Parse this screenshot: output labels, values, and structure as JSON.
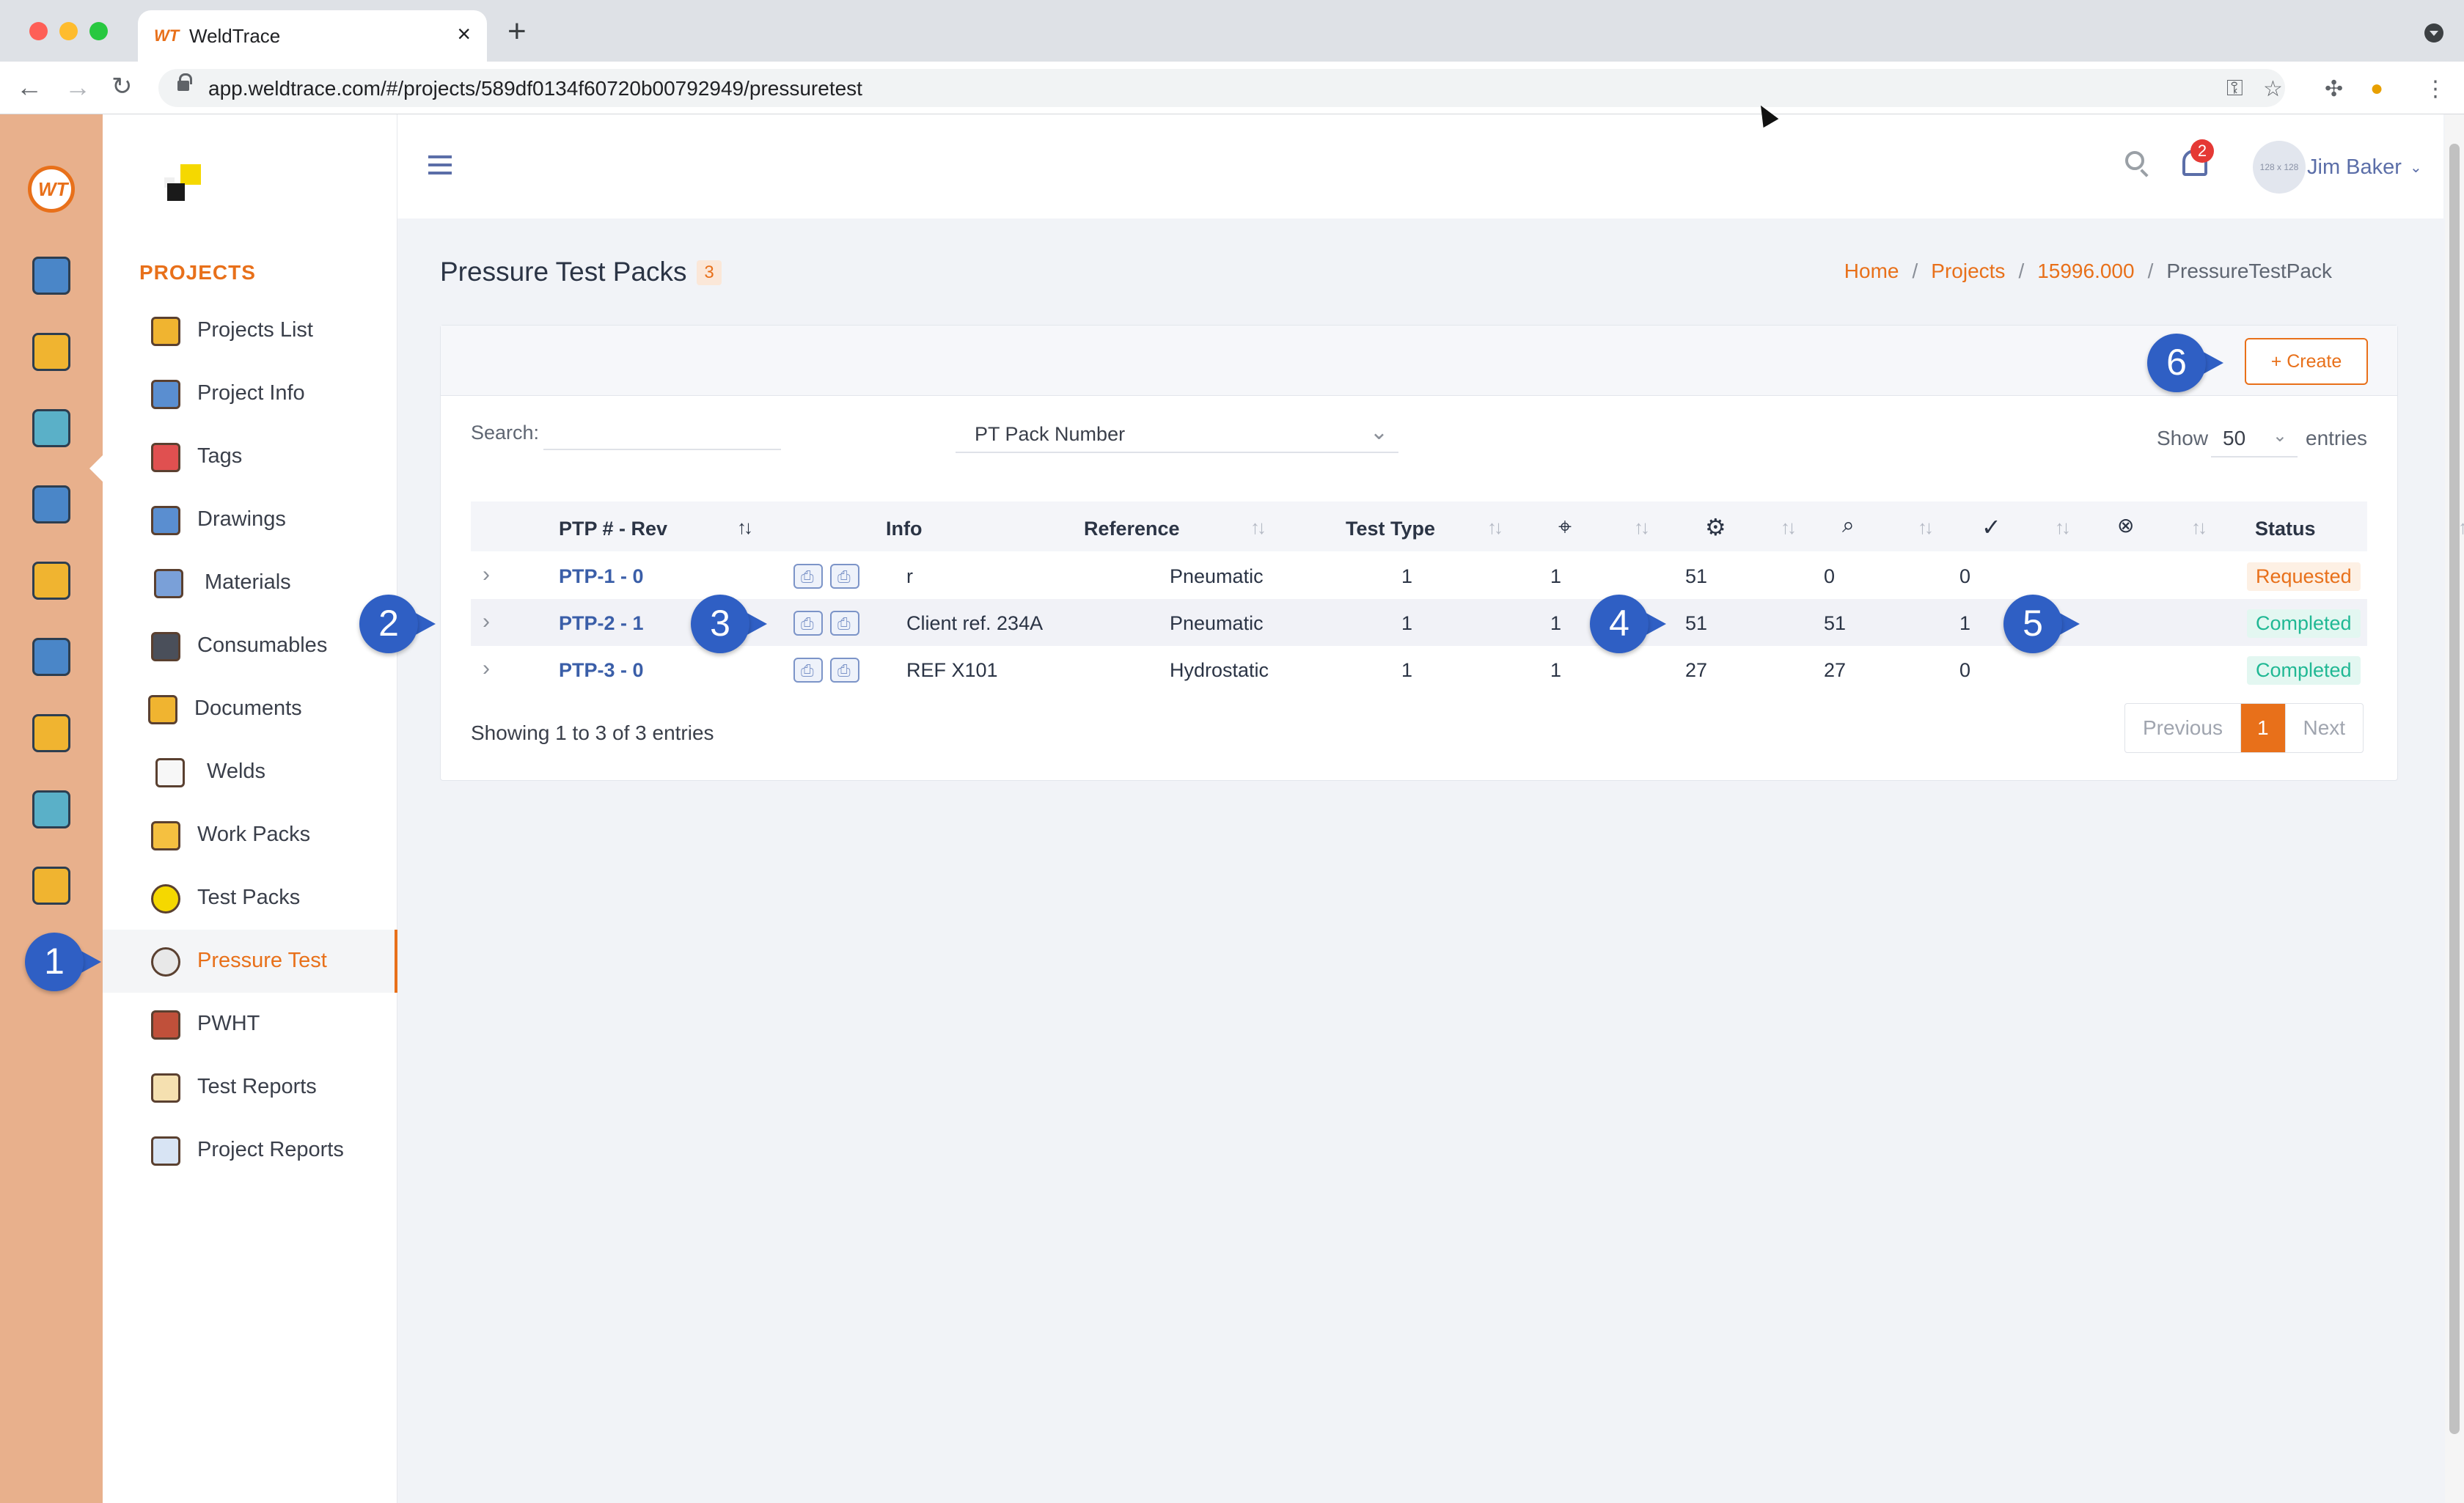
{
  "browser": {
    "tab_title": "WeldTrace",
    "tab_favicon": "WT",
    "url": "app.weldtrace.com/#/projects/589df0134f60720b00792949/pressuretest"
  },
  "sidebar": {
    "heading": "PROJECTS",
    "items": [
      {
        "label": "Projects List",
        "icon": "folder-camera-icon"
      },
      {
        "label": "Project Info",
        "icon": "gears-icon"
      },
      {
        "label": "Tags",
        "icon": "tag-icon"
      },
      {
        "label": "Drawings",
        "icon": "drawing-icon"
      },
      {
        "label": "Materials",
        "icon": "pipes-icon"
      },
      {
        "label": "Consumables",
        "icon": "spool-icon"
      },
      {
        "label": "Documents",
        "icon": "folder-icon"
      },
      {
        "label": "Welds",
        "icon": "weld-spark-icon"
      },
      {
        "label": "Work Packs",
        "icon": "package-icon"
      },
      {
        "label": "Test Packs",
        "icon": "radiation-icon"
      },
      {
        "label": "Pressure Test",
        "icon": "pressure-gauge-icon"
      },
      {
        "label": "PWHT",
        "icon": "heater-coil-icon"
      },
      {
        "label": "Test Reports",
        "icon": "clipboard-icon"
      },
      {
        "label": "Project Reports",
        "icon": "report-chart-icon"
      }
    ]
  },
  "header": {
    "notification_count": "2",
    "avatar_text": "128 x 128",
    "user_name": "Jim Baker"
  },
  "page": {
    "title": "Pressure Test Packs",
    "count": "3",
    "breadcrumb": {
      "home": "Home",
      "projects": "Projects",
      "project": "15996.000",
      "current": "PressureTestPack"
    }
  },
  "card": {
    "create_label": "+ Create",
    "search_label": "Search:",
    "search_value": "",
    "filter_value": "PT Pack Number",
    "show_label": "Show",
    "entries_value": "50",
    "entries_label": "entries"
  },
  "table": {
    "headers": {
      "ptp": "PTP # - Rev",
      "info": "Info",
      "reference": "Reference",
      "test_type": "Test Type",
      "status": "Status"
    },
    "rows": [
      {
        "ptp": "PTP-1 - 0",
        "reference": "r",
        "test_type": "Pneumatic",
        "c1": "1",
        "c2": "1",
        "c3": "51",
        "c4": "0",
        "c5": "0",
        "status": "Requested"
      },
      {
        "ptp": "PTP-2 - 1",
        "reference": "Client ref. 234A",
        "test_type": "Pneumatic",
        "c1": "1",
        "c2": "1",
        "c3": "51",
        "c4": "51",
        "c5": "1",
        "status": "Completed"
      },
      {
        "ptp": "PTP-3 - 0",
        "reference": "REF X101",
        "test_type": "Hydrostatic",
        "c1": "1",
        "c2": "1",
        "c3": "27",
        "c4": "27",
        "c5": "0",
        "status": "Completed"
      }
    ],
    "showing": "Showing 1 to 3 of 3 entries"
  },
  "pagination": {
    "previous": "Previous",
    "current": "1",
    "next": "Next"
  },
  "callouts": [
    "1",
    "2",
    "3",
    "4",
    "5",
    "6"
  ],
  "colors": {
    "accent": "#e8701a",
    "link": "#3a5ea8",
    "rail": "#e8b08c",
    "callout": "#2f5fc4",
    "requested": "#e8701a",
    "completed": "#20b894"
  }
}
